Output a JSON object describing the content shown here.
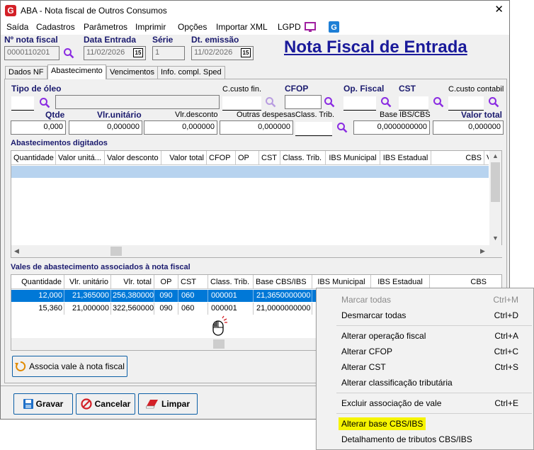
{
  "window": {
    "title": "ABA - Nota fiscal de Outros Consumos",
    "app_icon": "G",
    "close": "✕"
  },
  "menu": [
    "Saída",
    "Cadastros",
    "Parâmetros",
    "Imprimir",
    "Opções",
    "Importar XML",
    "LGPD"
  ],
  "header": {
    "nota_fiscal_label": "Nº nota fiscal",
    "nota_fiscal_value": "0000110201",
    "data_entrada_label": "Data Entrada",
    "data_entrada_value": "11/02/2026",
    "serie_label": "Série",
    "serie_value": "1",
    "dt_emissao_label": "Dt. emissão",
    "dt_emissao_value": "11/02/2026",
    "calendar_day": "15",
    "page_title": "Nota Fiscal de Entrada"
  },
  "tabs": [
    "Dados NF",
    "Abastecimento",
    "Vencimentos",
    "Info. compl. Sped"
  ],
  "form": {
    "tipo_oleo_label": "Tipo de óleo",
    "ccusto_fin_label": "C.custo fin.",
    "cfop_label": "CFOP",
    "op_fiscal_label": "Op. Fiscal",
    "cst_label": "CST",
    "ccusto_contabil_label": "C.custo contabil",
    "qtde_label": "Qtde",
    "qtde_value": "0,000",
    "vlr_unitario_label": "Vlr.unitário",
    "vlr_unitario_value": "0,000000",
    "vlr_desconto_label": "Vlr.desconto",
    "vlr_desconto_value": "0,000000",
    "outras_despesas_label": "Outras despesas",
    "outras_despesas_value": "0,000000",
    "class_trib_label": "Class. Trib.",
    "base_ibs_label": "Base IBS/CBS",
    "base_ibs_value": "0,0000000000",
    "valor_total_label": "Valor total",
    "valor_total_value": "0,000000"
  },
  "grid1": {
    "title": "Abastecimentos digitados",
    "columns": [
      "Quantidade",
      "Valor unitá...",
      "Valor desconto",
      "Valor total",
      "CFOP",
      "OP",
      "CST",
      "Class. Trib.",
      "IBS Municipal",
      "IBS Estadual",
      "CBS",
      "V"
    ]
  },
  "grid2": {
    "title": "Vales de abastecimento associados à nota fiscal",
    "columns": [
      "Quantidade",
      "Vlr. unitário",
      "Vlr. total",
      "OP",
      "CST",
      "Class. Trib.",
      "Base CBS/IBS",
      "IBS Municipal",
      "IBS Estadual",
      "CBS"
    ],
    "rows": [
      [
        "12,000",
        "21,365000",
        "256,380000",
        "090",
        "060",
        "000001",
        "21,3650000000"
      ],
      [
        "15,360",
        "21,000000",
        "322,560000",
        "090",
        "060",
        "000001",
        "21,0000000000"
      ]
    ]
  },
  "buttons": {
    "associa": "Associa vale à nota fiscal",
    "gravar": "Gravar",
    "cancelar": "Cancelar",
    "limpar": "Limpar"
  },
  "context_menu": {
    "items": [
      {
        "label": "Marcar todas",
        "shortcut": "Ctrl+M"
      },
      {
        "label": "Desmarcar todas",
        "shortcut": "Ctrl+D"
      },
      {
        "label": "Alterar operação fiscal",
        "shortcut": "Ctrl+A"
      },
      {
        "label": "Alterar CFOP",
        "shortcut": "Ctrl+C"
      },
      {
        "label": "Alterar CST",
        "shortcut": "Ctrl+S"
      },
      {
        "label": "Alterar classificação tributária",
        "shortcut": ""
      },
      {
        "label": "Excluir associação de vale",
        "shortcut": "Ctrl+E"
      },
      {
        "label": "Alterar base CBS/IBS",
        "shortcut": ""
      },
      {
        "label": "Detalhamento de tributos CBS/IBS",
        "shortcut": ""
      }
    ],
    "highlight_color": "#f6f400"
  },
  "colors": {
    "selection": "#0078d7",
    "title_blue": "#1a1a9a",
    "label_blue": "#1a1a6e"
  }
}
